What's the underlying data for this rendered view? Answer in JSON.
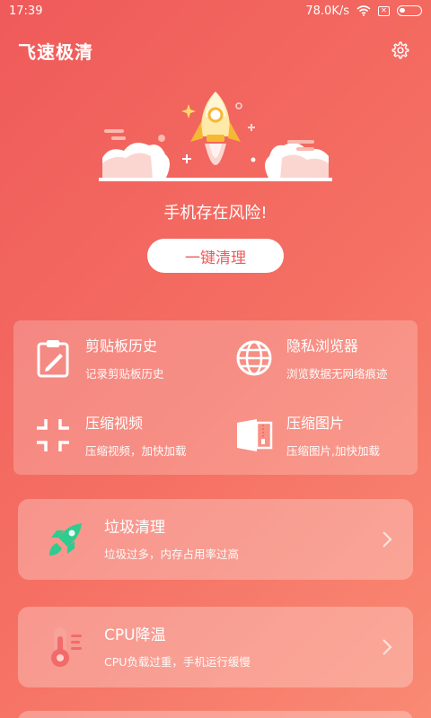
{
  "status_bar": {
    "time": "17:39",
    "network_speed": "78.0K/s",
    "sim_badge": "✕"
  },
  "header": {
    "title": "飞速极清"
  },
  "hero": {
    "status_text": "手机存在风险!",
    "clean_button": "一键清理"
  },
  "tools": [
    {
      "title": "剪贴板历史",
      "subtitle": "记录剪贴板历史",
      "icon": "clipboard-icon"
    },
    {
      "title": "隐私浏览器",
      "subtitle": "浏览数据无网络痕迹",
      "icon": "globe-icon"
    },
    {
      "title": "压缩视频",
      "subtitle": "压缩视频，加快加载",
      "icon": "compress-icon"
    },
    {
      "title": "压缩图片",
      "subtitle": "压缩图片,加快加载",
      "icon": "zip-file-icon"
    }
  ],
  "cards": [
    {
      "title": "垃圾清理",
      "subtitle": "垃圾过多，内存占用率过高",
      "icon": "rocket-icon",
      "icon_color": "#2fcb8f"
    },
    {
      "title": "CPU降温",
      "subtitle": "CPU负载过重，手机运行缓慢",
      "icon": "thermometer-icon",
      "icon_color": "#f36a6a"
    }
  ],
  "colors": {
    "background_start": "#ef5a5a",
    "background_end": "#f98a74",
    "accent": "#ef5a5a"
  }
}
